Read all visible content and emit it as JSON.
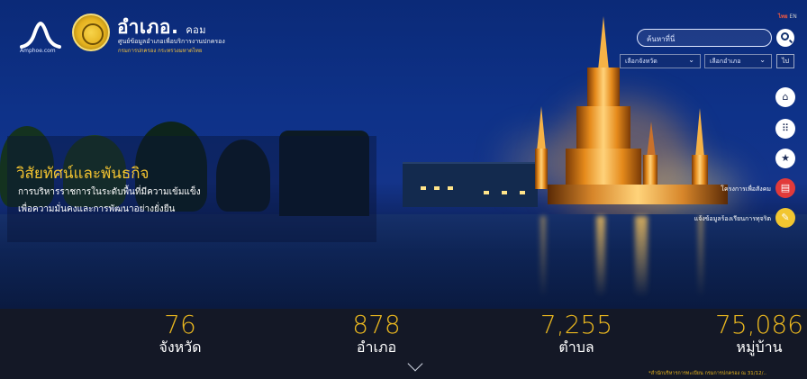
{
  "header": {
    "logo_caption": "Amphoe.com",
    "site_name": "อำเภอ.",
    "site_name_suffix": "คอม",
    "tagline": "ศูนย์ข้อมูลอำเภอเพื่อบริการงานปกครอง",
    "ministry": "กรมการปกครอง กระทรวงมหาดไทย",
    "lang_th": "ไทย",
    "lang_en": "EN"
  },
  "search": {
    "placeholder": "ค้นหาที่นี่",
    "province_select": "เลือกจังหวัด",
    "district_select": "เลือกอำเภอ",
    "go_label": "ไป"
  },
  "side_menu": {
    "item5_label": "โครงการเพื่อสังคม",
    "item6_label": "แจ้งข้อมูลร้องเรียนการทุจริต"
  },
  "mission": {
    "title": "วิสัยทัศน์และพันธกิจ",
    "line1": "การบริหารราชการในระดับพื้นที่มีความเข้มแข็ง",
    "line2": "เพื่อความมั่นคงและการพัฒนาอย่างยั่งยืน"
  },
  "stats": [
    {
      "value": "76",
      "label": "จังหวัด"
    },
    {
      "value": "878",
      "label": "อำเภอ"
    },
    {
      "value": "7,255",
      "label": "ตำบล"
    },
    {
      "value": "75,086",
      "label": "หมู่บ้าน"
    }
  ],
  "source_note": "*สำนักบริหารการทะเบียน กรมการปกครอง ณ 31/12/..",
  "colors": {
    "accent_gold": "#e7b51f",
    "stats_bg": "#141826",
    "sky_blue": "#0e3289"
  },
  "icons": [
    "home-icon",
    "grid-icon",
    "star-icon",
    "document-icon",
    "edit-icon",
    "search-icon",
    "chevron-down-icon"
  ]
}
